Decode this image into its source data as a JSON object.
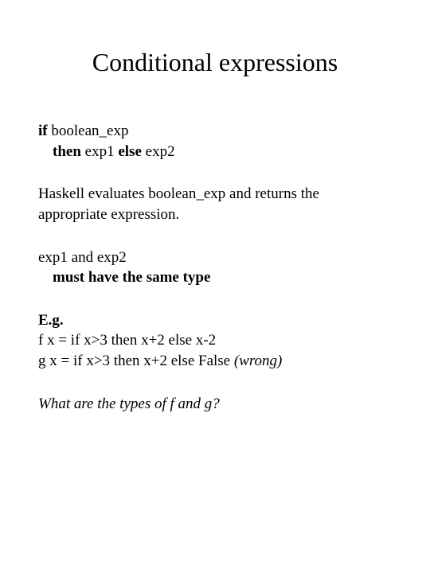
{
  "title": "Conditional expressions",
  "syntax": {
    "line1_if": "if",
    "line1_rest": " boolean_exp",
    "line2_then": "then",
    "line2_mid": "  exp1  ",
    "line2_else": "else",
    "line2_end": "  exp2"
  },
  "explain": "Haskell evaluates boolean_exp and returns the appropriate expression.",
  "typing": {
    "line1": "exp1 and exp2",
    "line2": "must have the same type"
  },
  "example": {
    "heading": "E.g.",
    "f": "f x = if x>3 then x+2 else x-2",
    "g_code": "g x = if x>3 then x+2 else False  ",
    "g_note": "(wrong)"
  },
  "question": "What are the types of f and g?"
}
